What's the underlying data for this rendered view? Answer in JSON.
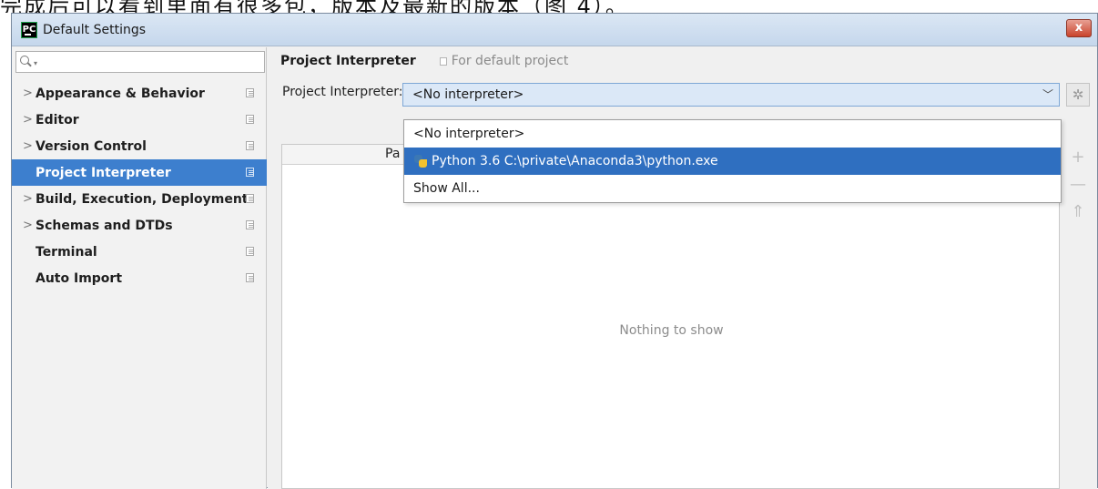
{
  "page_strip": {
    "text": "完成后可以看到里面有很多包，版本及最新的版本（图 4）。"
  },
  "window": {
    "title": "Default Settings",
    "app_icon_text": "PC",
    "close_label": "x"
  },
  "sidebar": {
    "search": {
      "value": "",
      "placeholder": ""
    },
    "items": [
      {
        "label": "Appearance & Behavior",
        "has_chevron": true
      },
      {
        "label": "Editor",
        "has_chevron": true
      },
      {
        "label": "Version Control",
        "has_chevron": true
      },
      {
        "label": "Project Interpreter",
        "has_chevron": false,
        "selected": true
      },
      {
        "label": "Build, Execution, Deployment",
        "has_chevron": true
      },
      {
        "label": "Schemas and DTDs",
        "has_chevron": true
      },
      {
        "label": "Terminal",
        "has_chevron": false
      },
      {
        "label": "Auto Import",
        "has_chevron": false
      }
    ]
  },
  "main": {
    "title": "Project Interpreter",
    "scope": "For default project",
    "interpreter_label": "Project Interpreter:",
    "interpreter_value": "<No interpreter>",
    "table": {
      "column_visible": "Pa",
      "empty_text": "Nothing to show"
    },
    "tools": {
      "add": "+",
      "remove": "—",
      "upgrade": "⇑"
    }
  },
  "dropdown": {
    "options": [
      "<No interpreter>",
      "Python 3.6 C:\\private\\Anaconda3\\python.exe",
      "Show All..."
    ],
    "highlighted_index": 1
  },
  "colors": {
    "selection": "#3d7fce",
    "dropdown_highlight": "#2f6fc0",
    "combo_bg": "#dbe8f7"
  }
}
